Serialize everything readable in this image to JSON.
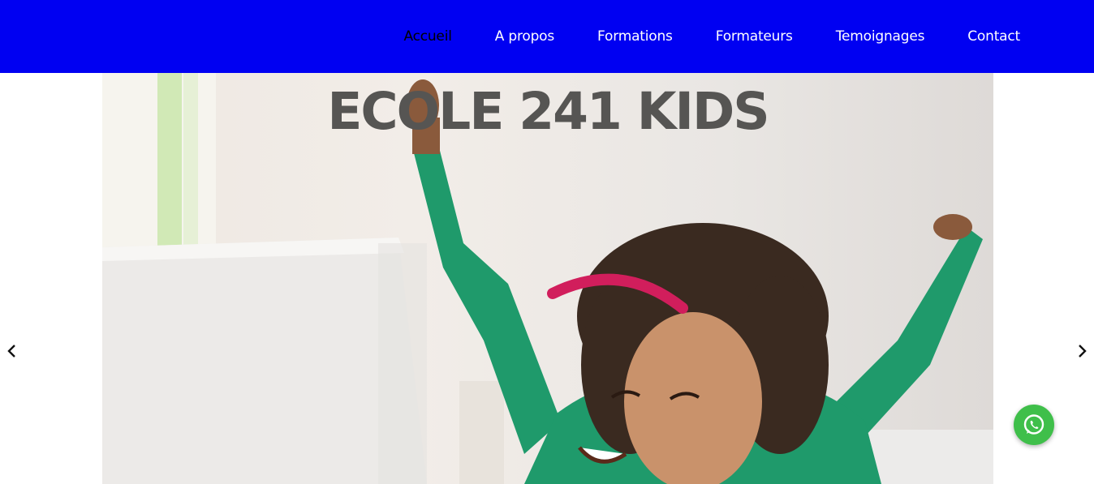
{
  "nav": {
    "items": [
      {
        "label": "Accueil",
        "active": true
      },
      {
        "label": "A propos",
        "active": false
      },
      {
        "label": "Formations",
        "active": false
      },
      {
        "label": "Formateurs",
        "active": false
      },
      {
        "label": "Temoignages",
        "active": false
      },
      {
        "label": "Contact",
        "active": false
      }
    ]
  },
  "hero": {
    "title": "ECOLE 241 KIDS"
  },
  "carousel": {
    "prev_icon": "chevron-left-icon",
    "next_icon": "chevron-right-icon"
  },
  "whatsapp": {
    "icon": "whatsapp-icon"
  },
  "colors": {
    "navbar_bg": "#0000f2",
    "nav_text": "#ffffff",
    "nav_active_text": "#000000",
    "hero_title": "#565553",
    "whatsapp_green": "#3fbf4a"
  }
}
